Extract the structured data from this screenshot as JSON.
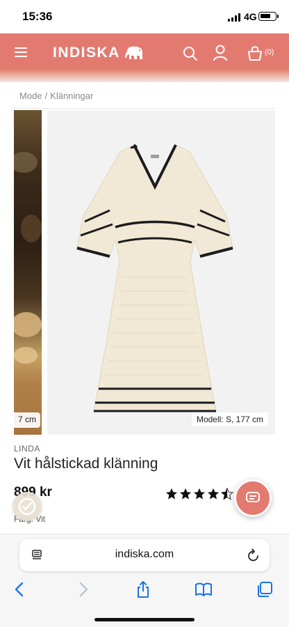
{
  "status_bar": {
    "time": "15:36",
    "network": "4G"
  },
  "header": {
    "logo_text": "INDISKA",
    "cart_count": "(0)",
    "background_color": "#e37a70",
    "icons": [
      "menu-icon",
      "elephant-icon",
      "search-icon",
      "user-icon",
      "cart-icon"
    ]
  },
  "breadcrumb": {
    "items": [
      "Mode",
      "Klänningar"
    ],
    "separator": "/"
  },
  "gallery": {
    "prev_caption": "7 cm",
    "model_info": "Modell: S, 177 cm"
  },
  "product": {
    "brand": "LINDA",
    "title": "Vit hålstickad klänning",
    "price": "899 kr",
    "rating": 4.5,
    "rating_max": 5,
    "color_line": "Färg: Vit"
  },
  "browser": {
    "url": "indiska.com"
  }
}
